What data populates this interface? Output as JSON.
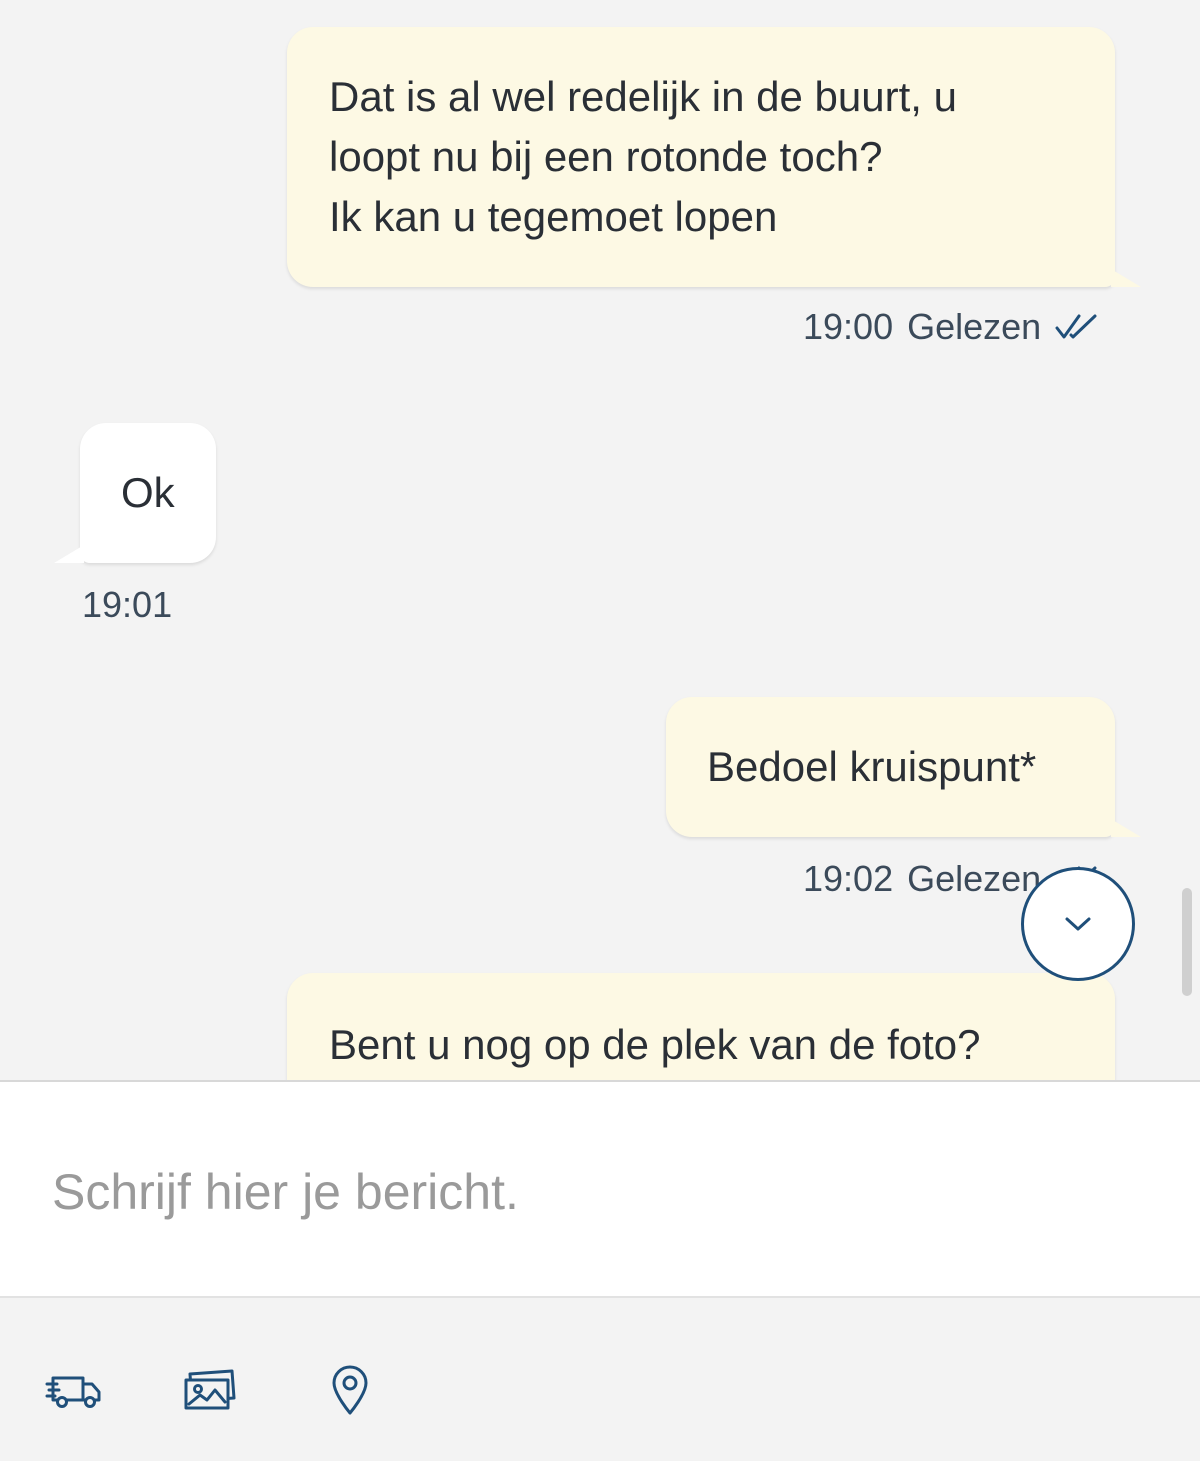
{
  "conversation": {
    "messages": [
      {
        "direction": "outgoing",
        "lines": [
          "Dat is al wel redelijk in de buurt, u",
          "loopt nu bij een rotonde toch?",
          "Ik kan u tegemoet lopen"
        ],
        "time": "19:00",
        "status": "Gelezen"
      },
      {
        "direction": "incoming",
        "lines": [
          "Ok"
        ],
        "time": "19:01"
      },
      {
        "direction": "outgoing",
        "lines": [
          "Bedoel kruispunt*"
        ],
        "time": "19:02",
        "status": "Gelezen"
      },
      {
        "direction": "outgoing",
        "lines": [
          "Bent u nog op de plek van de foto?"
        ]
      }
    ]
  },
  "composer": {
    "placeholder": "Schrijf hier je bericht."
  },
  "toolbar": {
    "buttons": [
      {
        "icon": "truck-icon"
      },
      {
        "icon": "photos-icon"
      },
      {
        "icon": "location-pin-icon"
      }
    ]
  },
  "colors": {
    "outgoing_bubble": "#fdf9e4",
    "incoming_bubble": "#ffffff",
    "accent": "#1f4f7a",
    "background": "#f3f3f3"
  }
}
